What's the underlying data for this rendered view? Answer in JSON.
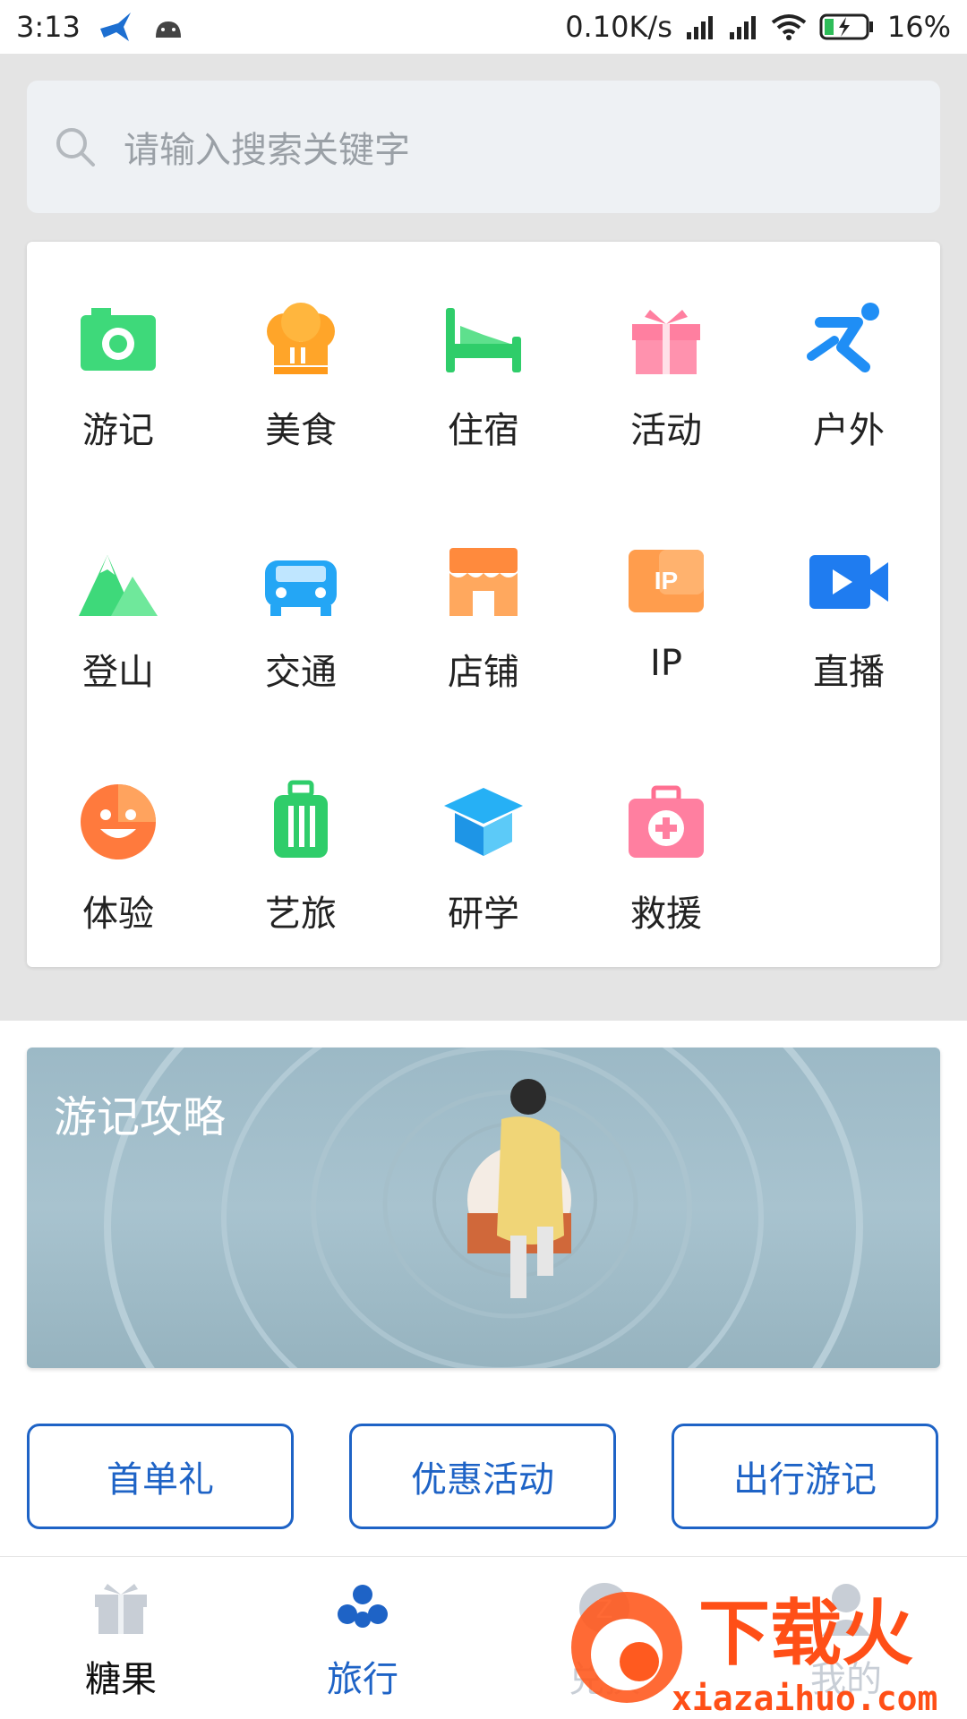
{
  "status_bar": {
    "time": "3:13",
    "speed": "0.10K/s",
    "battery": "16%"
  },
  "search": {
    "placeholder": "请输入搜索关键字"
  },
  "categories": [
    {
      "label": "游记",
      "icon": "camera-icon"
    },
    {
      "label": "美食",
      "icon": "chef-hat-icon"
    },
    {
      "label": "住宿",
      "icon": "bed-icon"
    },
    {
      "label": "活动",
      "icon": "gift-icon"
    },
    {
      "label": "户外",
      "icon": "runner-icon"
    },
    {
      "label": "登山",
      "icon": "mountain-icon"
    },
    {
      "label": "交通",
      "icon": "car-icon"
    },
    {
      "label": "店铺",
      "icon": "shop-icon"
    },
    {
      "label": "IP",
      "icon": "ip-badge-icon"
    },
    {
      "label": "直播",
      "icon": "video-camera-icon"
    },
    {
      "label": "体验",
      "icon": "smile-face-icon"
    },
    {
      "label": "艺旅",
      "icon": "suitcase-icon"
    },
    {
      "label": "研学",
      "icon": "graduation-cap-icon"
    },
    {
      "label": "救援",
      "icon": "first-aid-kit-icon"
    }
  ],
  "banner": {
    "title": "游记攻略"
  },
  "pills": [
    {
      "label": "首单礼"
    },
    {
      "label": "优惠活动"
    },
    {
      "label": "出行游记"
    }
  ],
  "bottom_nav": [
    {
      "label": "糖果",
      "icon": "gift-box-icon",
      "active": false
    },
    {
      "label": "旅行",
      "icon": "travel-flower-icon",
      "active": true
    },
    {
      "label": "兑换",
      "icon": "exchange-icon",
      "active": false
    },
    {
      "label": "我的",
      "icon": "profile-icon",
      "active": false
    }
  ],
  "watermark": {
    "brand": "下载火",
    "url": "xiazaihuo.com"
  },
  "colors": {
    "accent": "#1e63c6",
    "search_bg": "#eef1f4",
    "page_bg": "#e4e4e4"
  }
}
